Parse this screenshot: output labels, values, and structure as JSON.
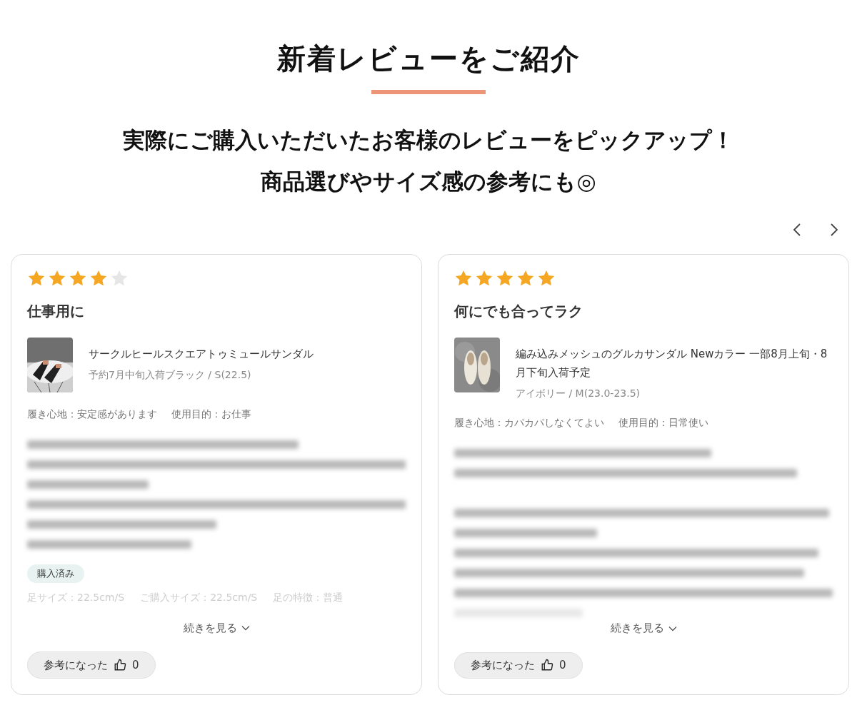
{
  "heading": "新着レビューをご紹介",
  "subtitle_lines": [
    "実際にご購入いただいたお客様のレビューをピックアップ！",
    "商品選びやサイズ感の参考にも◎"
  ],
  "reviews": [
    {
      "stars": 4,
      "title": "仕事用に",
      "product": {
        "name": "サークルヒールスクエアトゥミュールサンダル",
        "variant": "予約7月中旬入荷ブラック / S(22.5)"
      },
      "attributes": [
        "履き心地：安定感があります",
        "使用目的：お仕事"
      ],
      "badge": "購入済み",
      "foot_info": [
        "足サイズ：22.5cm/S",
        "ご購入サイズ：22.5cm/S",
        "足の特徴：普通"
      ],
      "more_label": "続きを見る",
      "helpful_label": "参考になった",
      "helpful_count": "0"
    },
    {
      "stars": 5,
      "title": "何にでも合ってラク",
      "product": {
        "name": "編み込みメッシュのグルカサンダル Newカラー 一部8月上旬・8月下旬入荷予定",
        "variant": "アイボリー / M(23.0-23.5)"
      },
      "attributes": [
        "履き心地：カパカパしなくてよい",
        "使用目的：日常使い"
      ],
      "more_label": "続きを見る",
      "helpful_label": "参考になった",
      "helpful_count": "0"
    }
  ]
}
